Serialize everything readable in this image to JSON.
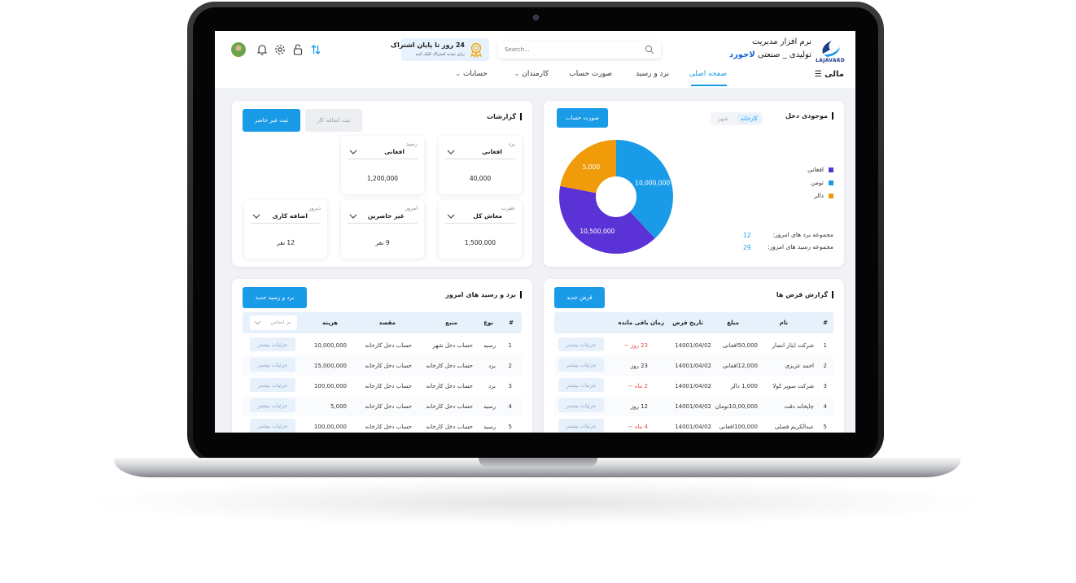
{
  "brand": {
    "logo_text": "LAJAVARD",
    "line1": "نرم افزار مدیریت",
    "line2_prefix": "تولیدی _ صنعتی",
    "line2_accent": "لاجورد"
  },
  "search": {
    "placeholder": "Search..."
  },
  "promo": {
    "title": "24 روز تا پایان اشتراک",
    "subtitle": "برای تمدید اشتراک کلیک کنید"
  },
  "nav": {
    "menu_title": "مالی",
    "items": [
      "صفحه اصلی",
      "برد و رسید",
      "صورت حساب",
      "کارمندان",
      "حسابات"
    ]
  },
  "income": {
    "title": "موجودی دخل",
    "tabs": [
      "کارخانه",
      "شهر"
    ],
    "button": "صورت حساب",
    "legend": [
      {
        "label": "افغانی",
        "color": "#5b32d6"
      },
      {
        "label": "تومن",
        "color": "#1a9be8"
      },
      {
        "label": "دالر",
        "color": "#f09c0a"
      }
    ],
    "pie": [
      {
        "label": "10,000,000",
        "value": 10000000,
        "color": "#1a9be8"
      },
      {
        "label": "10,500,000",
        "value": 10500000,
        "color": "#5b32d6"
      },
      {
        "label": "5,000",
        "value": 5000,
        "color": "#f09c0a"
      }
    ],
    "sum_bord_label": "مجموعه برد های امروز:",
    "sum_bord_value": "12",
    "sum_rasid_label": "مجموعه رسید های امروز:",
    "sum_rasid_value": "29"
  },
  "reports": {
    "title": "گزارشات",
    "btn_absent": "ثبت غیر حاضر",
    "btn_overtime": "ثبت اضافه کار",
    "cards": [
      {
        "label": "برد",
        "select": "افغانی",
        "value": "40,000"
      },
      {
        "label": "رسید",
        "select": "افغانی",
        "value": "1,200,000"
      },
      {
        "label": "عقرب",
        "select": "معاش کل",
        "value": "1,500,000"
      },
      {
        "label": "امروز",
        "select": "غیر حاضرین",
        "value": "9 نفر"
      },
      {
        "label": "دیروز",
        "select": "اضافه کاری",
        "value": "12 نفر"
      }
    ]
  },
  "loans": {
    "title": "گزارش قرض ها",
    "button": "قرض جدید",
    "columns": [
      "#",
      "نام",
      "مبلغ",
      "تاریخ قرض",
      "زمان باقی مانده"
    ],
    "action_label": "جزئیات بیشتر",
    "rows": [
      {
        "n": "1",
        "name": "شرکت ایثار انصار",
        "amount": "50,000افغانی",
        "date": "14001/04/02",
        "remain": "23 روز −",
        "overdue": true
      },
      {
        "n": "2",
        "name": "احمد عزیزی",
        "amount": "12,000افغانی",
        "date": "14001/04/02",
        "remain": "23 روز",
        "overdue": false
      },
      {
        "n": "3",
        "name": "شرکت سوپر کولا",
        "amount": "1,000 دالر",
        "date": "14001/04/02",
        "remain": "2 ماه −",
        "overdue": true
      },
      {
        "n": "4",
        "name": "چاپخانه دقت",
        "amount": "10,00,000تومان",
        "date": "14001/04/02",
        "remain": "12 روز",
        "overdue": false
      },
      {
        "n": "5",
        "name": "عبدالکریم فضلی",
        "amount": "100,000افغانی",
        "date": "14001/04/02",
        "remain": "4 ماه −",
        "overdue": true
      }
    ]
  },
  "transfers": {
    "title": "برد و رسید های امروز",
    "button": "برد و رسید جدید",
    "columns": [
      "#",
      "نوع",
      "منبع",
      "مقصد",
      "هزینه"
    ],
    "filter_placeholder": "بر اساس",
    "action_label": "جزئیات بیشتر",
    "rows": [
      {
        "n": "1",
        "type": "رسید",
        "source": "حساب دخل شهر",
        "dest": "حساب دخل کارخانه",
        "cost": "10,000,000"
      },
      {
        "n": "2",
        "type": "برد",
        "source": "حساب دخل کارخانه",
        "dest": "حساب دخل کارخانه",
        "cost": "15,000,000"
      },
      {
        "n": "3",
        "type": "برد",
        "source": "حساب دخل کارخانه",
        "dest": "حساب دخل کارخانه",
        "cost": "100,00,000"
      },
      {
        "n": "4",
        "type": "رسید",
        "source": "حساب دخل کارخانه",
        "dest": "حساب دخل کارخانه",
        "cost": "5,000"
      },
      {
        "n": "5",
        "type": "رسید",
        "source": "حساب دخل کارخانه",
        "dest": "حساب دخل کارخانه",
        "cost": "100,00,000"
      }
    ]
  }
}
